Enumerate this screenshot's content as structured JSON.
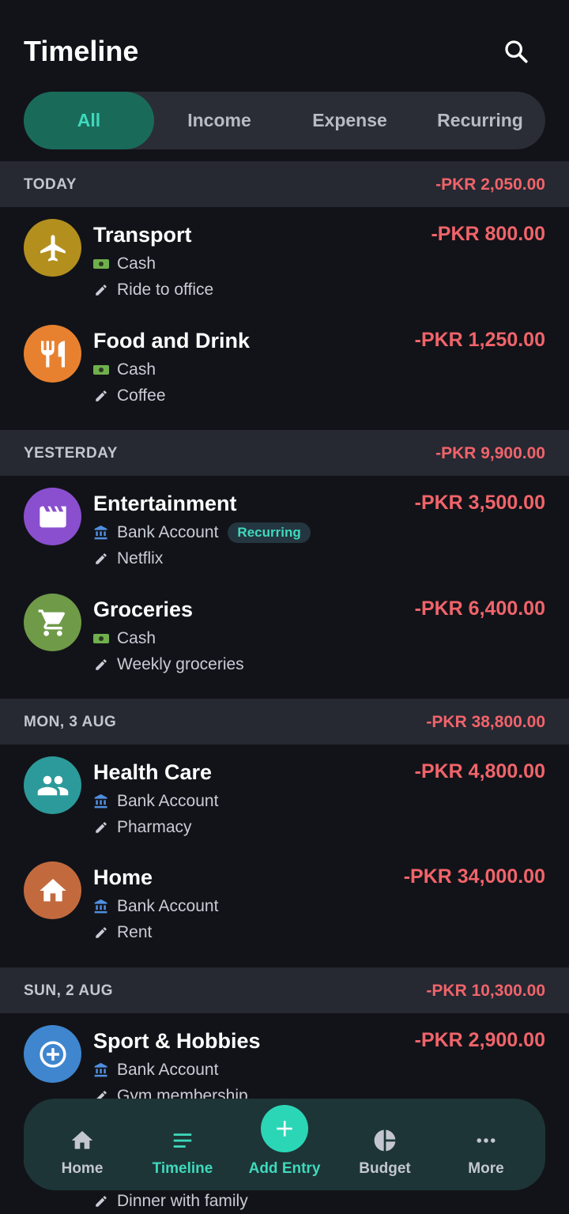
{
  "header": {
    "title": "Timeline",
    "search_icon": "search-icon"
  },
  "tabs": [
    {
      "label": "All",
      "active": true
    },
    {
      "label": "Income",
      "active": false
    },
    {
      "label": "Expense",
      "active": false
    },
    {
      "label": "Recurring",
      "active": false
    }
  ],
  "sections": [
    {
      "label": "TODAY",
      "total": "-PKR 2,050.00",
      "entries": [
        {
          "name": "Transport",
          "amount": "-PKR 800.00",
          "account": "Cash",
          "note": "Ride to office",
          "icon": "airplane-icon",
          "account_icon": "cash-icon",
          "color": "#b38f1e"
        },
        {
          "name": "Food and Drink",
          "amount": "-PKR 1,250.00",
          "account": "Cash",
          "note": "Coffee",
          "icon": "fork-knife-icon",
          "account_icon": "cash-icon",
          "color": "#e8812f"
        }
      ]
    },
    {
      "label": "YESTERDAY",
      "total": "-PKR 9,900.00",
      "entries": [
        {
          "name": "Entertainment",
          "amount": "-PKR 3,500.00",
          "account": "Bank Account",
          "badge": "Recurring",
          "note": "Netflix",
          "icon": "clapperboard-icon",
          "account_icon": "bank-icon",
          "color": "#8a4fcf"
        },
        {
          "name": "Groceries",
          "amount": "-PKR 6,400.00",
          "account": "Cash",
          "note": "Weekly groceries",
          "icon": "cart-icon",
          "account_icon": "cash-icon",
          "color": "#6f9a48"
        }
      ]
    },
    {
      "label": "MON, 3 AUG",
      "total": "-PKR 38,800.00",
      "entries": [
        {
          "name": "Health Care",
          "amount": "-PKR 4,800.00",
          "account": "Bank Account",
          "note": "Pharmacy",
          "icon": "people-icon",
          "account_icon": "bank-icon",
          "color": "#2c9a9a"
        },
        {
          "name": "Home",
          "amount": "-PKR 34,000.00",
          "account": "Bank Account",
          "note": "Rent",
          "icon": "house-icon",
          "account_icon": "bank-icon",
          "color": "#c26a3e"
        }
      ]
    },
    {
      "label": "SUN, 2 AUG",
      "total": "-PKR 10,300.00",
      "entries": [
        {
          "name": "Sport & Hobbies",
          "amount": "-PKR 2,900.00",
          "account": "Bank Account",
          "note": "Gym membership",
          "icon": "target-icon",
          "account_icon": "bank-icon",
          "color": "#3f86cf"
        }
      ]
    }
  ],
  "partial_entry": {
    "note": "Dinner with family",
    "color": "#d2732f"
  },
  "bottom_nav": [
    {
      "label": "Home",
      "icon": "home-icon",
      "active": false
    },
    {
      "label": "Timeline",
      "icon": "timeline-icon",
      "active": true
    },
    {
      "label": "Add Entry",
      "icon": "plus-icon",
      "active": false
    },
    {
      "label": "Budget",
      "icon": "pie-chart-icon",
      "active": false
    },
    {
      "label": "More",
      "icon": "more-icon",
      "active": false
    }
  ]
}
